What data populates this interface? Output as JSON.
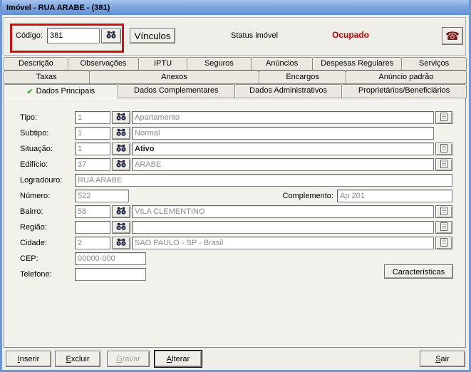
{
  "window": {
    "title": "Imóvel - RUA ARABE - (381)"
  },
  "icons": {
    "check": "✔",
    "phone": "☎"
  },
  "colors": {
    "status_occupied": "#C00000",
    "highlight_box": "#C81414",
    "check_green": "#1E9E1E"
  },
  "header": {
    "codigo_label": "Código:",
    "codigo_value": "381",
    "vinculos_button": "Vínculos",
    "status_label": "Status imóvel",
    "status_value": "Ocupado"
  },
  "tabs": {
    "row1": [
      "Descrição",
      "Observações",
      "IPTU",
      "Seguros",
      "Anúncios",
      "Despesas Regulares",
      "Serviços"
    ],
    "row2": [
      "Taxas",
      "Anexos",
      "Encargos",
      "Anúncio padrão"
    ],
    "row3": [
      "Dados Principais",
      "Dados Complementares",
      "Dados Administrativos",
      "Proprietários/Beneficiários"
    ],
    "active_tab": "Dados Principais"
  },
  "form": {
    "tipo": {
      "label": "Tipo:",
      "code": "1",
      "value": "Apartamento"
    },
    "subtipo": {
      "label": "Subtipo:",
      "code": "1",
      "value": "Normal"
    },
    "situacao": {
      "label": "Situação:",
      "code": "1",
      "value": "Ativo"
    },
    "edificio": {
      "label": "Edifício:",
      "code": "37",
      "value": "ARABE"
    },
    "logradouro": {
      "label": "Logradouro:",
      "value": "RUA ARABE"
    },
    "numero": {
      "label": "Número:",
      "value": "522"
    },
    "complemento": {
      "label": "Complemento:",
      "value": "Ap 201"
    },
    "bairro": {
      "label": "Bairro:",
      "code": "58",
      "value": "VILA CLEMENTINO"
    },
    "regiao": {
      "label": "Região:",
      "code": "",
      "value": ""
    },
    "cidade": {
      "label": "Cidade:",
      "code": "2",
      "value": "SAO PAULO - SP - Brasil"
    },
    "cep": {
      "label": "CEP:",
      "value": "00000-000"
    },
    "telefone": {
      "label": "Telefone:",
      "value": ""
    },
    "caracteristicas_button": "Características"
  },
  "footer": {
    "inserir": "Inserir",
    "excluir": "Excluir",
    "gravar": "Gravar",
    "alterar": "Alterar",
    "sair": "Sair"
  }
}
